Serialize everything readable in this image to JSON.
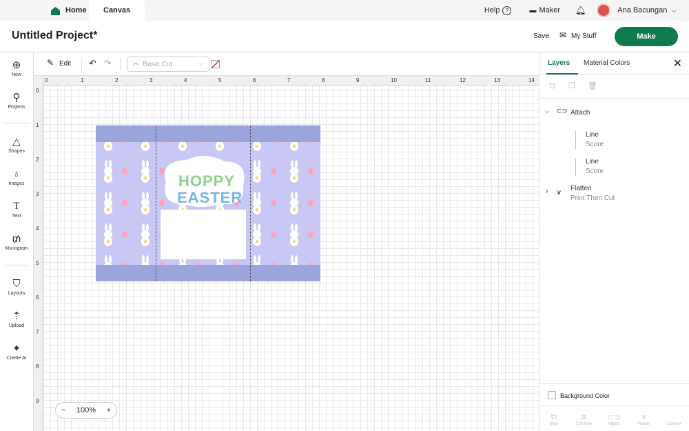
{
  "topbar": {
    "home_label": "Home",
    "canvas_label": "Canvas",
    "help_label": "Help",
    "maker_label": "Maker",
    "user_name": "Ana Bacungan"
  },
  "header": {
    "project_title": "Untitled Project*",
    "save_label": "Save",
    "mystuff_label": "My Stuff",
    "make_label": "Make"
  },
  "leftnav": {
    "items": [
      {
        "label": "New",
        "icon": "plus-circle-icon"
      },
      {
        "label": "Projects",
        "icon": "rocket-icon"
      },
      {
        "label": "Shapes",
        "icon": "shapes-icon"
      },
      {
        "label": "Images",
        "icon": "lightbulb-icon"
      },
      {
        "label": "Text",
        "icon": "text-icon"
      },
      {
        "label": "Monogram",
        "icon": "monogram-icon"
      },
      {
        "label": "Layouts",
        "icon": "shirt-icon"
      },
      {
        "label": "Upload",
        "icon": "upload-icon"
      },
      {
        "label": "Create AI",
        "icon": "sparkle-icon"
      }
    ]
  },
  "toolbar": {
    "edit_label": "Edit",
    "operation_select": "Basic Cut"
  },
  "ruler": {
    "top": [
      "0",
      "1",
      "2",
      "3",
      "4",
      "5",
      "6",
      "7",
      "8",
      "9",
      "10",
      "11",
      "12",
      "13",
      "14"
    ],
    "left": [
      "0",
      "1",
      "2",
      "3",
      "4",
      "5",
      "6",
      "7",
      "8",
      "9"
    ]
  },
  "canvas": {
    "design_text_line1": "HOPPY",
    "design_text_line2": "EASTER",
    "background_color": "#c9c7f4",
    "band_color": "#9ba5db"
  },
  "zoom": {
    "value": "100%"
  },
  "panel": {
    "tabs": [
      "Layers",
      "Material Colors"
    ],
    "group_label": "Attach",
    "layers": [
      {
        "name": "Line",
        "type": "Score"
      },
      {
        "name": "Line",
        "type": "Score"
      }
    ],
    "flatten": {
      "name": "Flatten",
      "type": "Print Then Cut"
    },
    "background_color_label": "Background Color",
    "footer_tools": [
      "Slice",
      "Combine",
      "Attach",
      "Flatten",
      "Contour"
    ]
  },
  "colors": {
    "accent": "#107a4f"
  }
}
